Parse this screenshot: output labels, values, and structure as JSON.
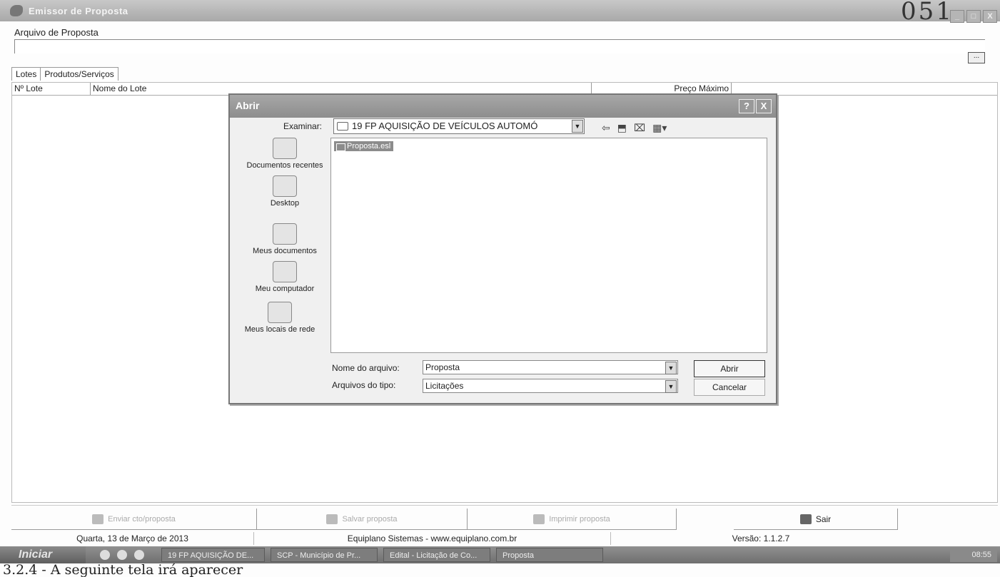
{
  "window": {
    "title": "Emissor de Proposta",
    "page_stamp": "051"
  },
  "window_buttons": {
    "minimize": "_",
    "maximize": "□",
    "close": "X"
  },
  "arquivo": {
    "label": "Arquivo de Proposta",
    "value": "",
    "browse_label": "..."
  },
  "tabs": [
    {
      "label": "Lotes"
    },
    {
      "label": "Produtos/Serviços"
    }
  ],
  "grid": {
    "columns": [
      "Nº Lote",
      "Nome do Lote",
      "Preço Máximo"
    ]
  },
  "bottom_buttons": [
    {
      "label": "Enviar cto/proposta",
      "icon": "send-icon",
      "enabled": false
    },
    {
      "label": "Salvar proposta",
      "icon": "save-icon",
      "enabled": false
    },
    {
      "label": "Imprimir proposta",
      "icon": "print-icon",
      "enabled": false
    },
    {
      "label": "Sair",
      "icon": "exit-icon",
      "enabled": true
    }
  ],
  "status": {
    "date": "Quarta, 13 de Março de 2013",
    "company": "Equiplano Sistemas - www.equiplano.com.br",
    "version": "Versão: 1.1.2.7"
  },
  "taskbar": {
    "start_label": "Iniciar",
    "tasks": [
      "19 FP AQUISIÇÃO DE...",
      "SCP - Município de Pr...",
      "Edital - Licitação de Co...",
      "Proposta"
    ],
    "clock": "08:55"
  },
  "caption": "3.2.4 - A seguinte tela irá aparecer",
  "dialog": {
    "title": "Abrir",
    "help_label": "?",
    "close_label": "X",
    "look_in_label": "Examinar:",
    "look_in_value": "19 FP AQUISIÇÃO DE VEÍCULOS AUTOMÓ",
    "toolbar_icons": [
      "back-icon",
      "up-folder-icon",
      "new-folder-icon",
      "view-menu-icon"
    ],
    "places": [
      {
        "label": "Documentos recentes",
        "icon": "recent-documents-icon"
      },
      {
        "label": "Desktop",
        "icon": "desktop-icon"
      },
      {
        "label": "Meus documentos",
        "icon": "my-documents-icon"
      },
      {
        "label": "Meu computador",
        "icon": "my-computer-icon"
      },
      {
        "label": "Meus locais de rede",
        "icon": "network-places-icon"
      }
    ],
    "files": [
      {
        "name": "Proposta.esl"
      }
    ],
    "filename_label": "Nome do arquivo:",
    "filename_value": "Proposta",
    "filetype_label": "Arquivos do tipo:",
    "filetype_value": "Licitações",
    "open_button": "Abrir",
    "cancel_button": "Cancelar"
  }
}
